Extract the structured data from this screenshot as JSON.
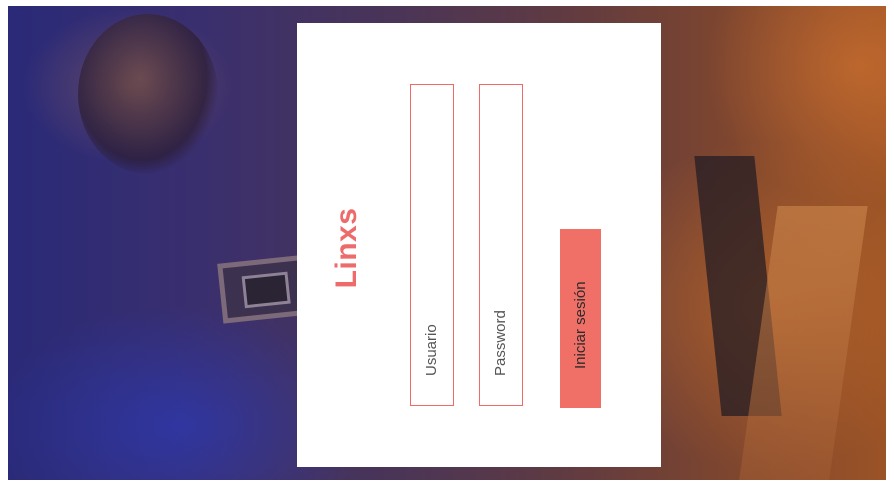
{
  "brand": {
    "title": "Linxs",
    "color": "#ee6b6b"
  },
  "login_form": {
    "username_placeholder": "Usuario",
    "password_placeholder": "Password",
    "submit_label": "Iniciar sesión",
    "submit_color": "#f07068"
  },
  "background": {
    "description_colors": [
      "#2a2a78",
      "#5e3a43",
      "#9b5326"
    ]
  }
}
